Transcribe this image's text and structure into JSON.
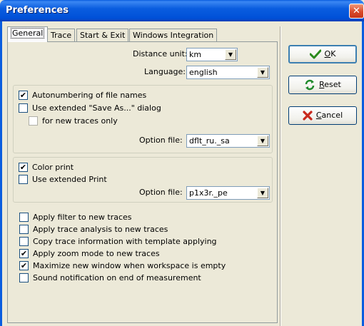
{
  "window": {
    "title": "Preferences",
    "close_glyph": "✕"
  },
  "tabs": [
    {
      "label": "General"
    },
    {
      "label": "Trace"
    },
    {
      "label": "Start & Exit"
    },
    {
      "label": "Windows Integration"
    }
  ],
  "general": {
    "distance_unit": {
      "label": "Distance unit:",
      "value": "km"
    },
    "language": {
      "label": "Language:",
      "value": "english"
    },
    "files_group": {
      "autonumbering": {
        "label": "Autonumbering of file names",
        "checked": true
      },
      "extended_save": {
        "label": "Use extended \"Save As...\" dialog",
        "checked": false
      },
      "new_traces_only": {
        "label": "for new traces only",
        "checked": false
      },
      "option_file": {
        "label": "Option file:",
        "value": "dflt_ru._sa"
      }
    },
    "print_group": {
      "color_print": {
        "label": "Color print",
        "checked": true
      },
      "extended_print": {
        "label": "Use extended Print",
        "checked": false
      },
      "option_file": {
        "label": "Option file:",
        "value": "p1x3r._pe"
      }
    },
    "options": [
      {
        "label": "Apply filter to new traces",
        "checked": false
      },
      {
        "label": "Apply trace analysis to new traces",
        "checked": false
      },
      {
        "label": "Copy trace information with template applying",
        "checked": false
      },
      {
        "label": "Apply zoom mode to new traces",
        "checked": true
      },
      {
        "label": "Maximize new window when workspace is empty",
        "checked": true
      },
      {
        "label": "Sound notification on end of measurement",
        "checked": false
      }
    ]
  },
  "buttons": {
    "ok": {
      "hotkey": "O",
      "rest": "K",
      "icon": "check-icon",
      "icon_color": "#2a8a1c"
    },
    "reset": {
      "hotkey": "R",
      "rest": "eset",
      "icon": "refresh-icon",
      "icon_color": "#1f8a2c"
    },
    "cancel": {
      "hotkey": "C",
      "rest": "ancel",
      "icon": "x-icon",
      "icon_color": "#c8281c"
    }
  },
  "check_glyph": "✔",
  "arrow_glyph": "▼"
}
